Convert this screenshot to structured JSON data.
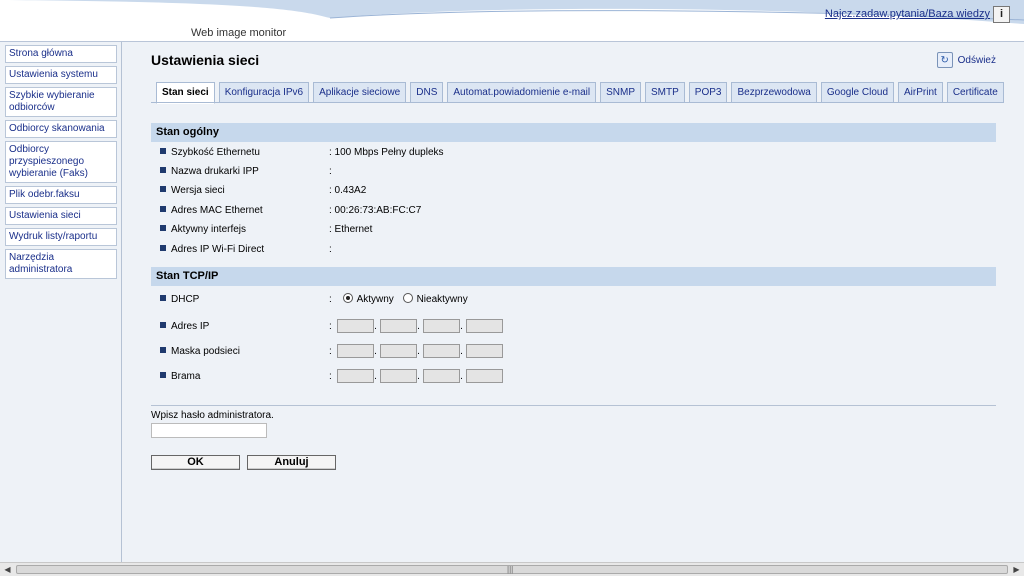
{
  "header": {
    "help_link": "Najcz.zadaw.pytania/Baza wiedzy",
    "help_icon": "i",
    "product": "Web image monitor"
  },
  "sidebar": {
    "items": [
      {
        "label": "Strona główna"
      },
      {
        "label": "Ustawienia systemu"
      },
      {
        "label": "Szybkie wybieranie odbiorców"
      },
      {
        "label": "Odbiorcy skanowania"
      },
      {
        "label": "Odbiorcy przyspieszonego wybieranie (Faks)"
      },
      {
        "label": "Plik odebr.faksu"
      },
      {
        "label": "Ustawienia sieci"
      },
      {
        "label": "Wydruk listy/raportu"
      },
      {
        "label": "Narzędzia administratora"
      }
    ]
  },
  "main": {
    "title": "Ustawienia sieci",
    "refresh_label": "Odśwież",
    "tabs": [
      {
        "label": "Stan sieci",
        "active": true
      },
      {
        "label": "Konfiguracja IPv6"
      },
      {
        "label": "Aplikacje sieciowe"
      },
      {
        "label": "DNS"
      },
      {
        "label": "Automat.powiadomienie e-mail"
      },
      {
        "label": "SNMP"
      },
      {
        "label": "SMTP"
      },
      {
        "label": "POP3"
      },
      {
        "label": "Bezprzewodowa"
      },
      {
        "label": "Google Cloud"
      },
      {
        "label": "AirPrint"
      },
      {
        "label": "Certificate"
      }
    ],
    "general": {
      "heading": "Stan ogólny",
      "rows": [
        {
          "label": "Szybkość Ethernetu",
          "value": ": 100 Mbps Pełny dupleks"
        },
        {
          "label": "Nazwa drukarki IPP",
          "value": ":"
        },
        {
          "label": "Wersja sieci",
          "value": ": 0.43A2"
        },
        {
          "label": "Adres MAC Ethernet",
          "value": ": 00:26:73:AB:FC:C7"
        },
        {
          "label": "Aktywny interfejs",
          "value": ": Ethernet"
        },
        {
          "label": "Adres IP Wi-Fi Direct",
          "value": ":"
        }
      ]
    },
    "tcpip": {
      "heading": "Stan TCP/IP",
      "dhcp_label": "DHCP",
      "colon": ":",
      "dhcp_on": "Aktywny",
      "dhcp_off": "Nieaktywny",
      "ip_label": "Adres IP",
      "mask_label": "Maska podsieci",
      "gateway_label": "Brama"
    },
    "password_prompt": "Wpisz hasło administratora.",
    "ok_label": "OK",
    "cancel_label": "Anuluj"
  }
}
